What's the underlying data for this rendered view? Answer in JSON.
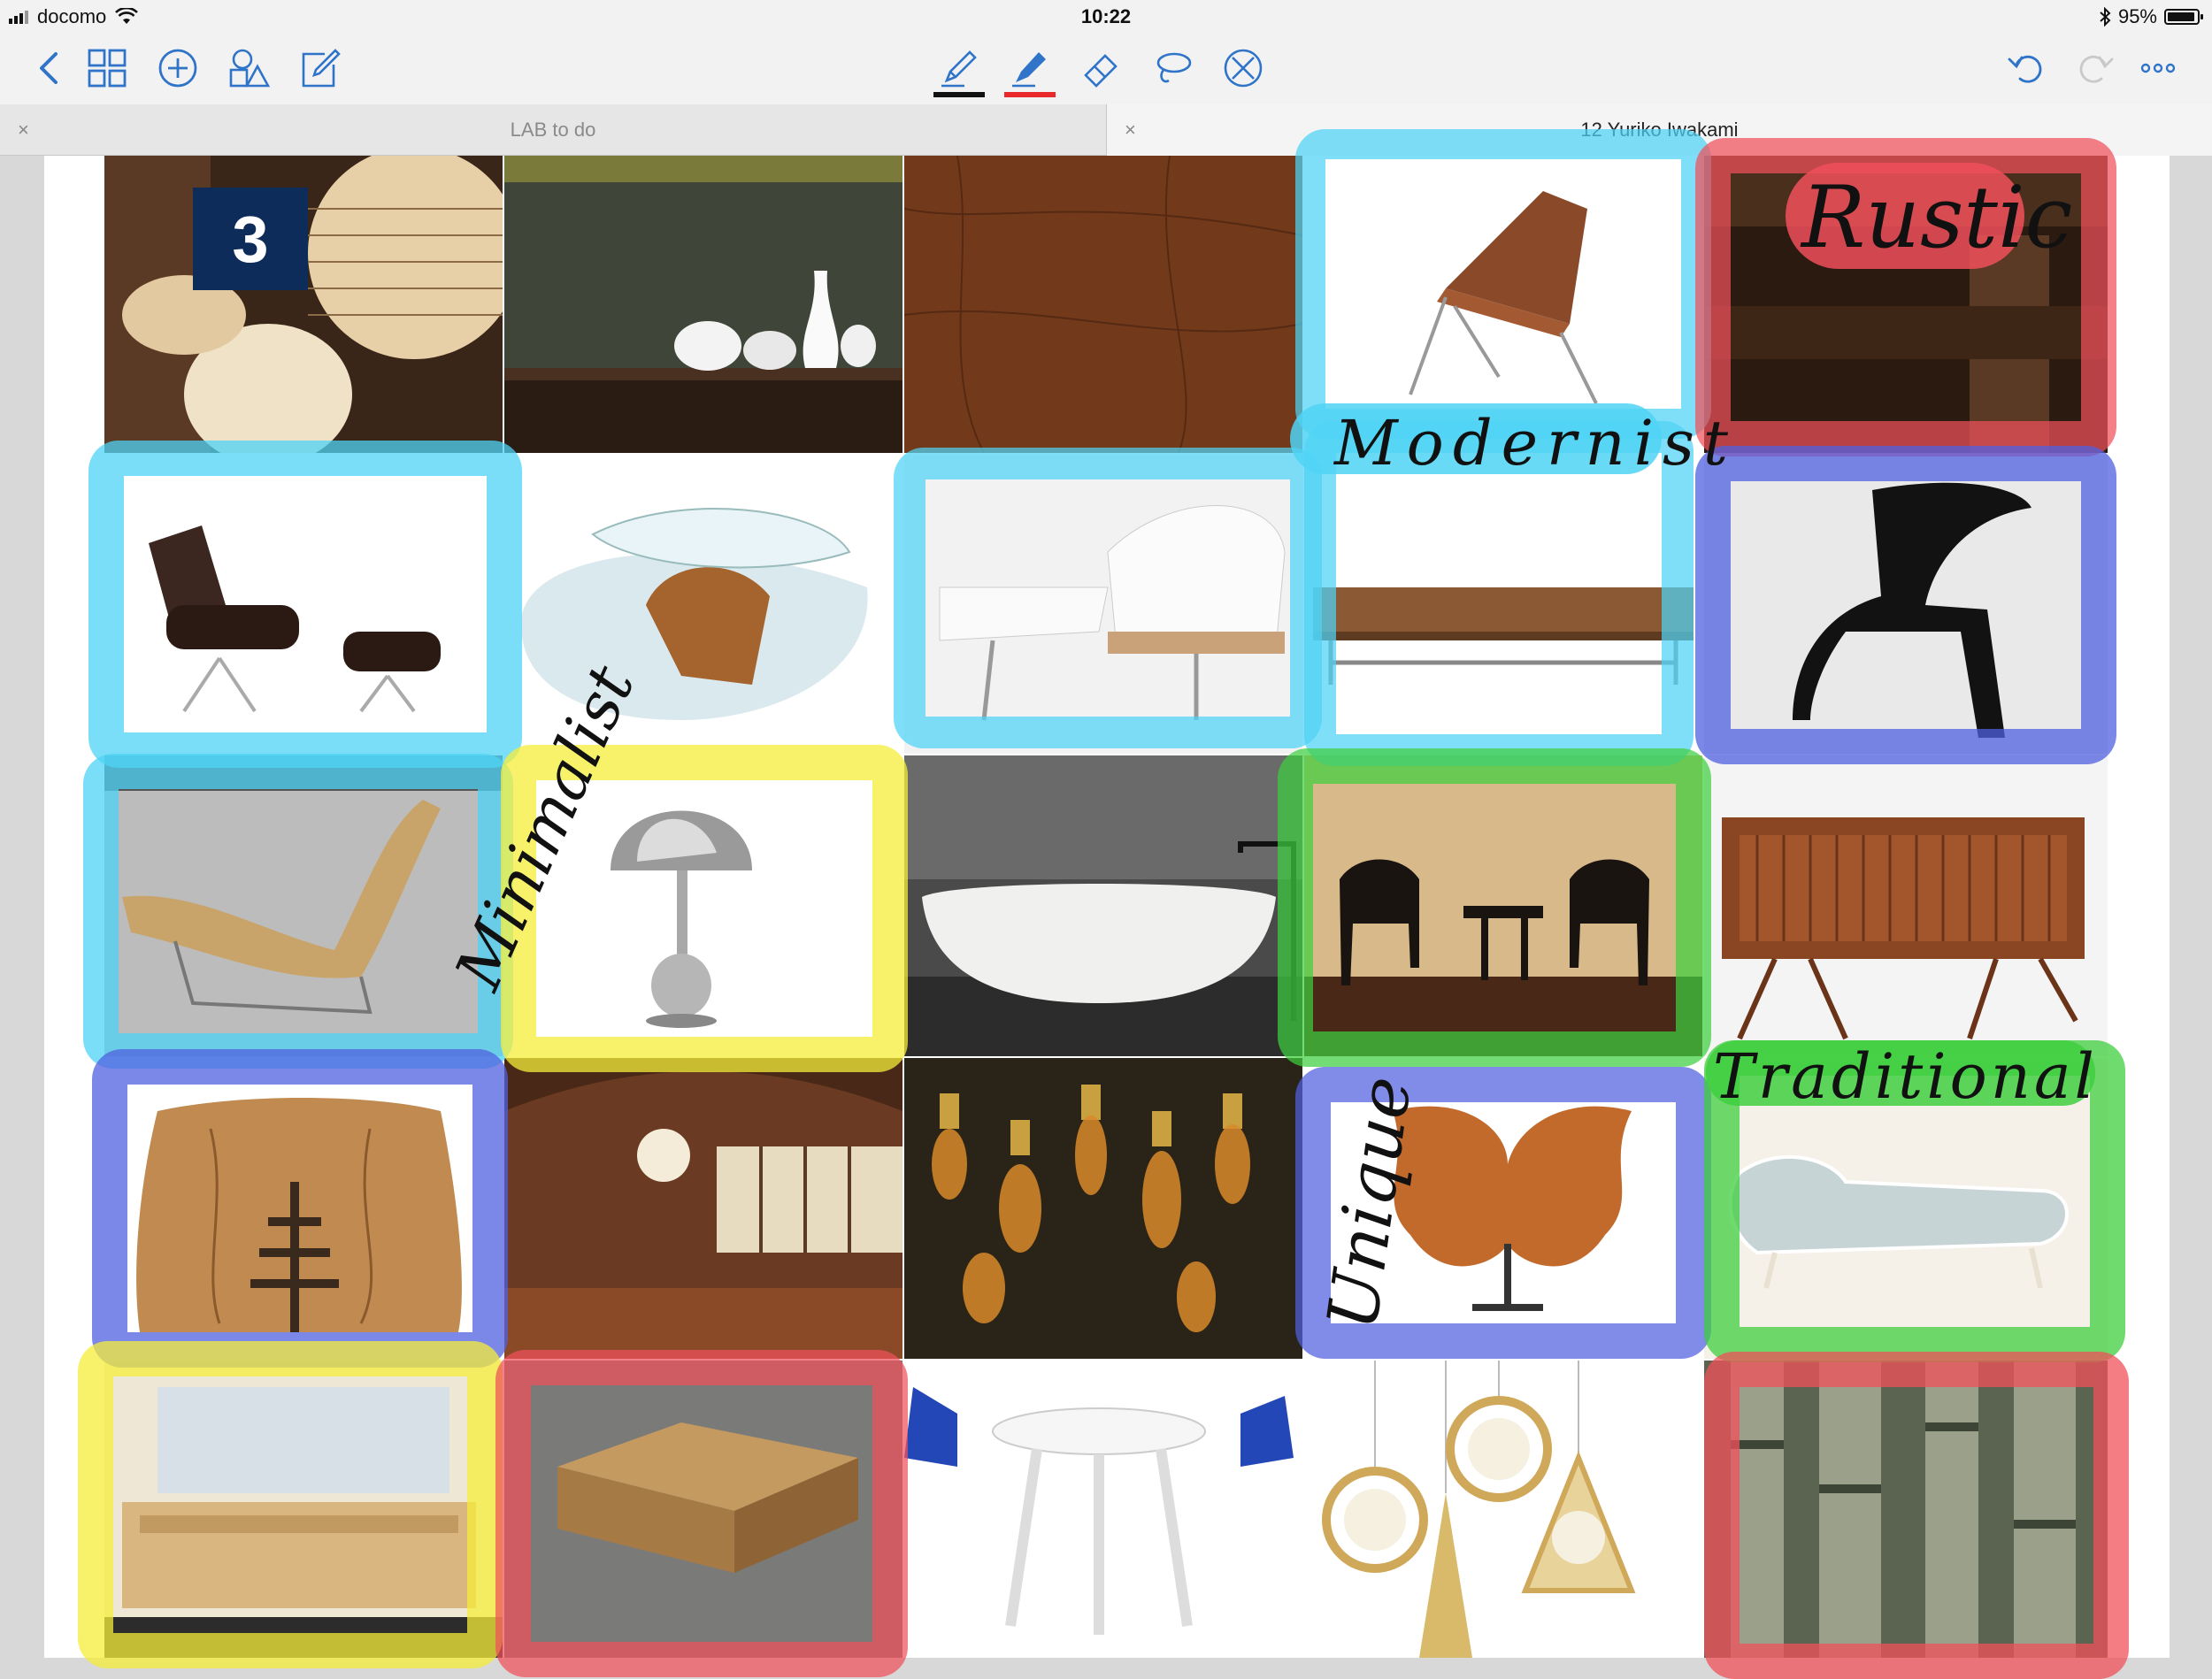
{
  "status_bar": {
    "carrier": "docomo",
    "time": "10:22",
    "battery_percent": "95%",
    "battery_level": 0.95
  },
  "toolbar": {
    "left_icons": [
      "back-chevron-icon",
      "grid-view-icon",
      "add-circle-icon",
      "shapes-icon",
      "compose-icon"
    ],
    "center_tools": [
      {
        "name": "pen-tool",
        "underline_color": "#111111"
      },
      {
        "name": "highlighter-tool",
        "underline_color": "#e8282b",
        "selected": true
      },
      {
        "name": "eraser-tool"
      },
      {
        "name": "lasso-tool"
      },
      {
        "name": "no-input-tool"
      }
    ],
    "right_icons": [
      "undo-icon",
      "redo-icon",
      "more-icon"
    ],
    "accent_color": "#2f74c9"
  },
  "tabs": [
    {
      "label": "LAB to do",
      "active": false
    },
    {
      "label": "12 Yuriko Iwakami",
      "active": true
    }
  ],
  "document": {
    "page_badge": "3",
    "handwritten_labels": {
      "rustic": "Rustic",
      "modernist": "Modernist",
      "minimalist": "Minimalist",
      "unique": "Unique",
      "traditional": "Traditional"
    },
    "highlight_colors": {
      "cyan": "#4fd3f5",
      "blue": "#5060e0",
      "green": "#3fcf3f",
      "yellow": "#f6ee3a",
      "red": "#f0505a"
    },
    "image_grid": [
      [
        "paper-lanterns",
        "white-vases-shelf",
        "leather-texture",
        "leather-lounge-chair",
        "rustic-wood-beam"
      ],
      [
        "eames-lounge-chair",
        "glass-coffee-table",
        "white-lounge-chair",
        "leather-daybed",
        "black-sculpted-chair"
      ],
      [
        "rattan-chaise",
        "chrome-dome-lamp",
        "stone-bathtub",
        "wicker-chairs-room",
        "wood-sideboard"
      ],
      [
        "live-edge-table",
        "japanese-interior",
        "edison-bulbs",
        "burl-wood-sculpture",
        "chaise-longue"
      ],
      [
        "wooden-bathtub",
        "wood-block-table",
        "white-table-blue-chairs",
        "brass-pendant-lights",
        "birch-trunks"
      ]
    ]
  }
}
